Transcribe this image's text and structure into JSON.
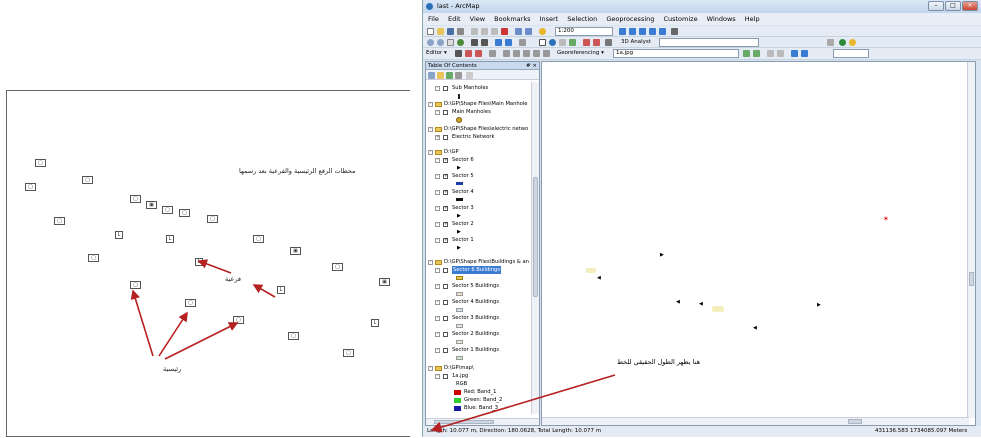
{
  "left_drawing": {
    "title_note": "محطات الرفع الرئيسية والفرعية بعد رسمها",
    "label_branch": "فرعية",
    "label_main": "رئيسية"
  },
  "arcmap": {
    "title": "last - ArcMap",
    "menu": [
      "File",
      "Edit",
      "View",
      "Bookmarks",
      "Insert",
      "Selection",
      "Geoprocessing",
      "Customize",
      "Windows",
      "Help"
    ],
    "scale": "1:200",
    "analyst_label": "3D Analyst",
    "editor_label": "Editor",
    "georef_label": "Georeferencing",
    "georef_layer": "1a.jpg",
    "toc_title": "Table Of Contents",
    "toc_close": "# ×",
    "toc_rows": [
      "Sub Manholes",
      "D:\\GP\\Shape Files\\Main Manhole",
      "Main Manholes",
      "D:\\GP\\Shape Files\\electric netwo",
      "Electric Network",
      "D:\\GP",
      "Sector 6",
      "Sector 5",
      "Sector 4",
      "Sector 3",
      "Sector 2",
      "Sector 1",
      "D:\\GP\\Shape Files\\Buildings & an",
      "Sector 6 Buildings",
      "Sector 5 Buildings",
      "Sector 4 Buildings",
      "Sector 3 Buildings",
      "Sector 2 Buildings",
      "Sector 1 Buildings",
      "D:\\GP\\map\\",
      "1a.jpg",
      "RGB",
      "Red:  Band_1",
      "Green: Band_2",
      "Blue:  Band_3"
    ],
    "map_note": "هنا يظهر الطول الحقيقي للخط",
    "status_left": "Length: 10.077 m, Direction: 180.0628, Total Length: 10.077 m",
    "status_coords": "431136.583  1734085.097 Meters",
    "colors": {
      "red": "#cc0000",
      "green": "#33cc33",
      "blue": "#1a1aa6",
      "selection": "#3b7bd4"
    }
  }
}
